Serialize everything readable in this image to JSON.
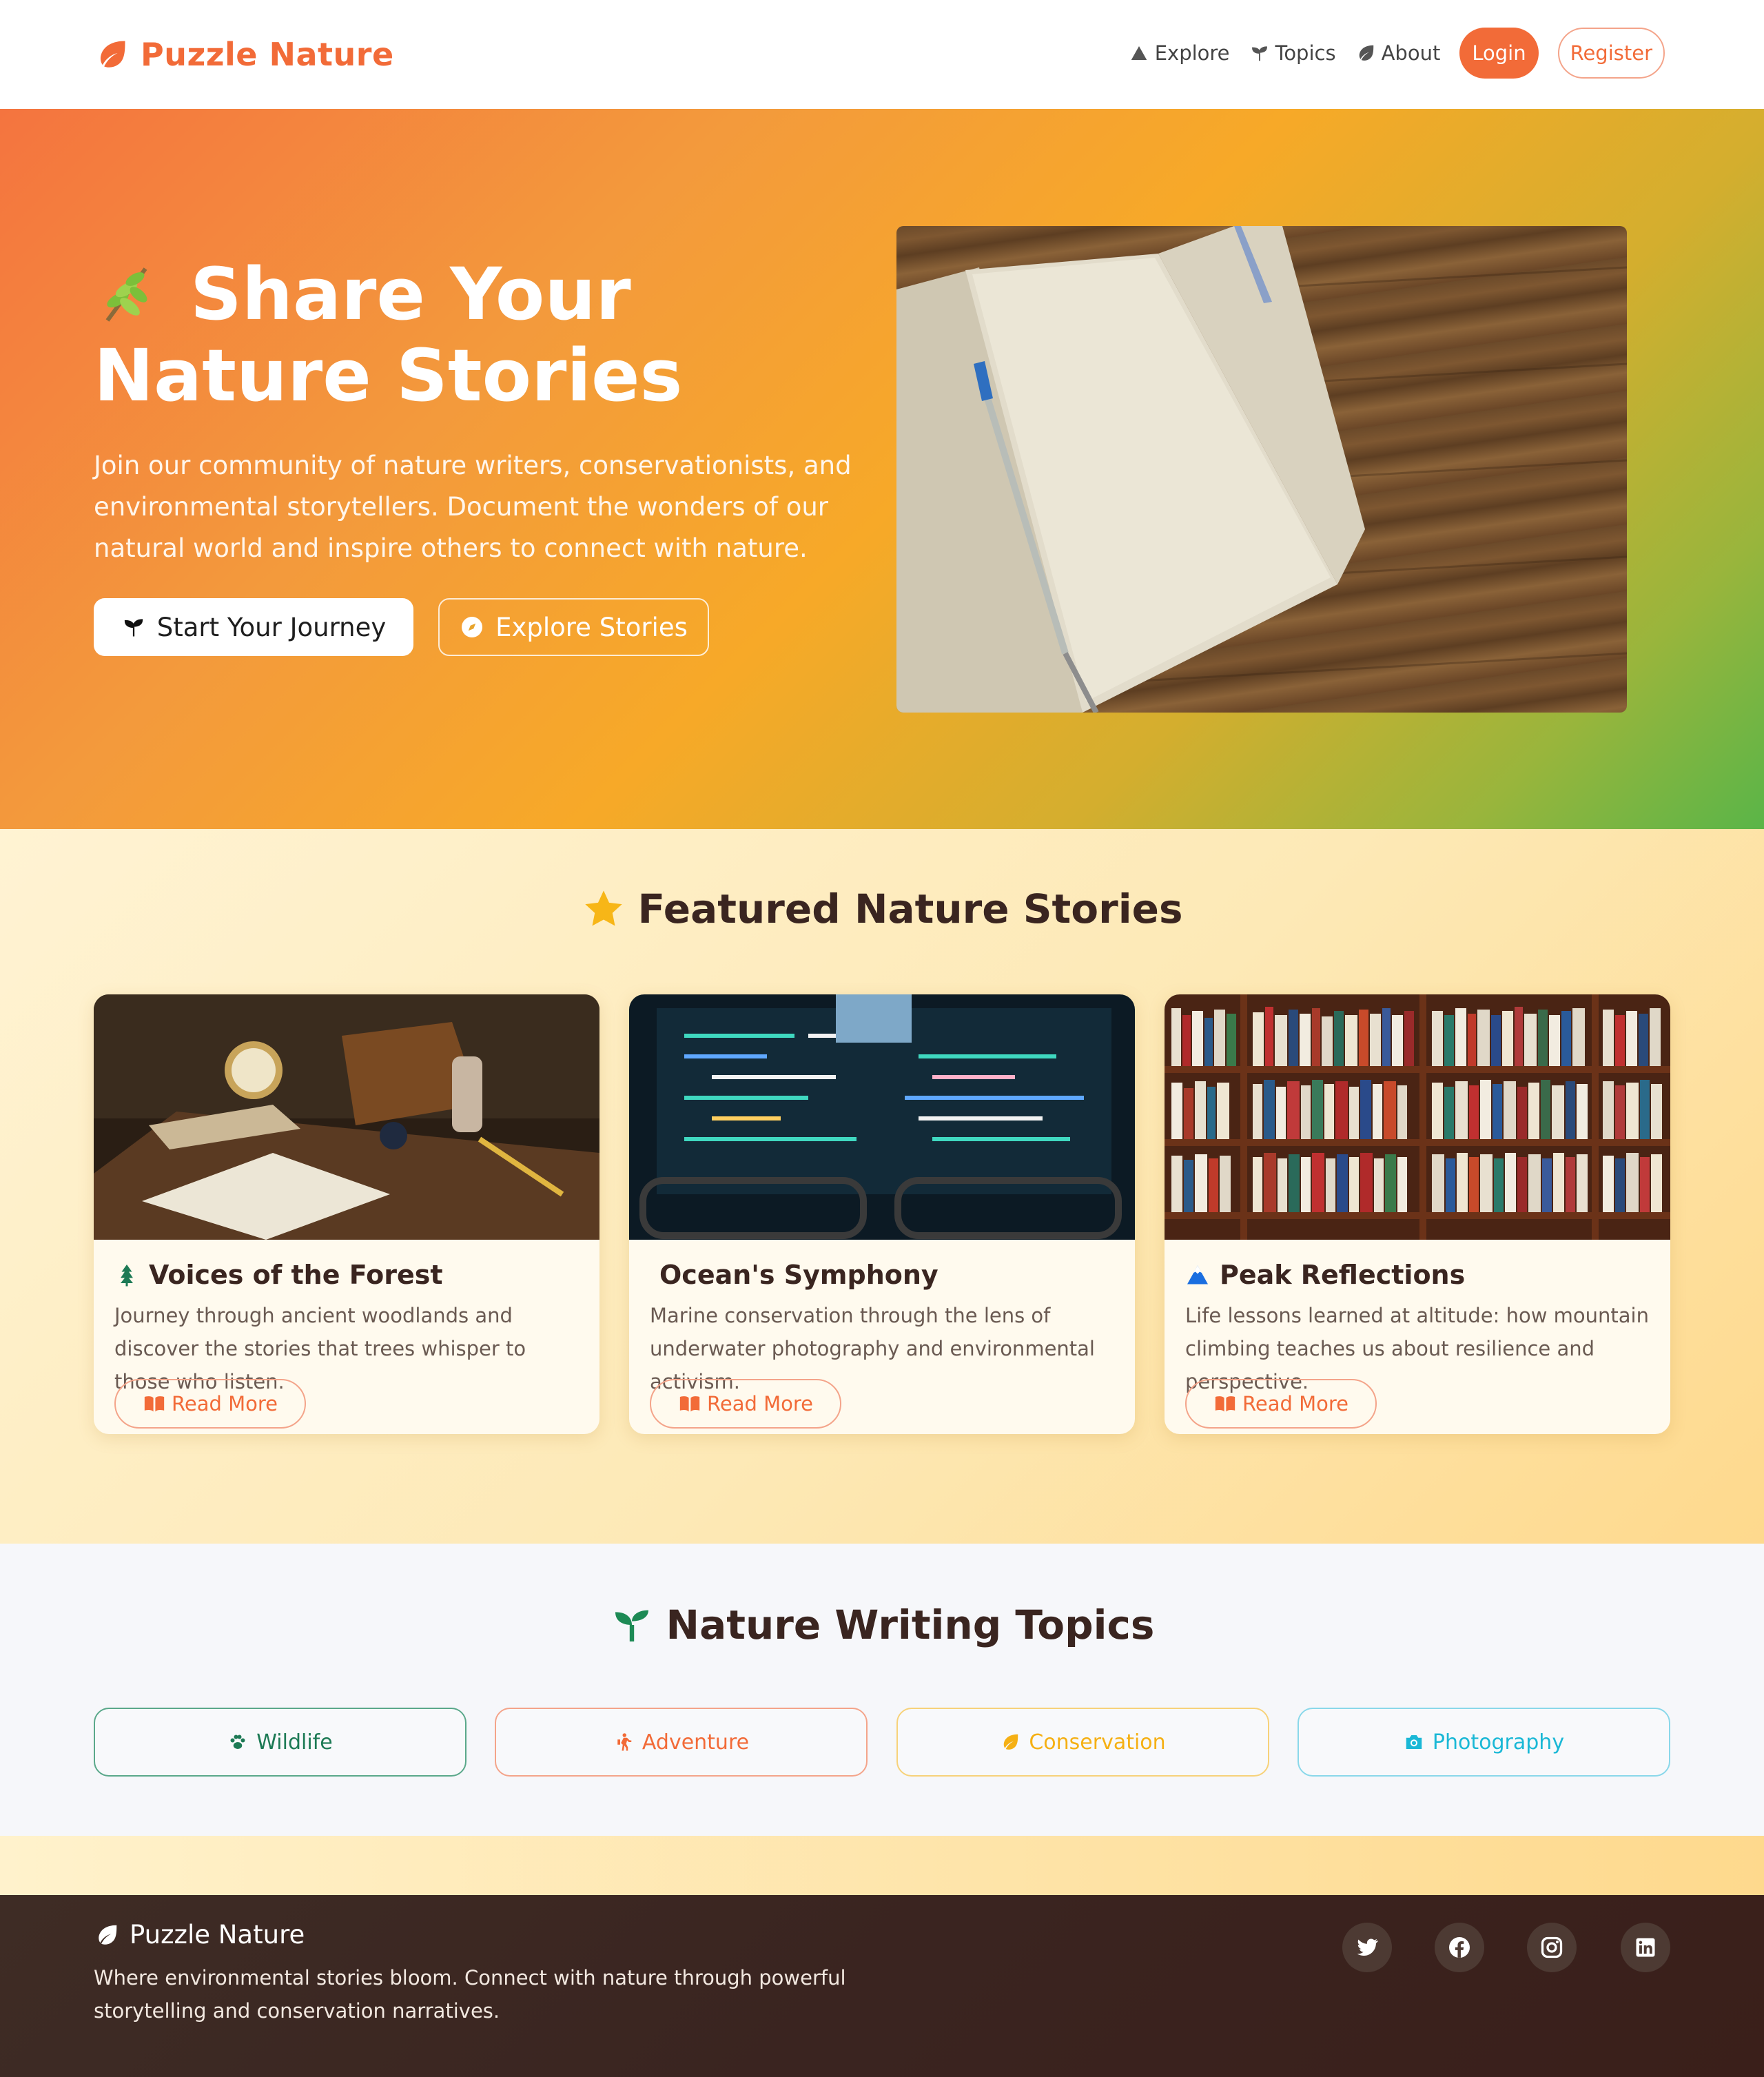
{
  "navbar": {
    "brand": "Puzzle Nature",
    "links": [
      {
        "label": "Explore",
        "icon": "mountain-icon"
      },
      {
        "label": "Topics",
        "icon": "seedling-icon"
      },
      {
        "label": "About",
        "icon": "leaf-icon"
      }
    ],
    "login": "Login",
    "register": "Register"
  },
  "hero": {
    "title": "Share Your Nature Stories",
    "description": "Join our community of nature writers, conservationists, and environmental storytellers. Document the wonders of our natural world and inspire others to connect with nature.",
    "primary_button": "Start Your Journey",
    "secondary_button": "Explore Stories"
  },
  "featured": {
    "heading": "Featured Nature Stories",
    "cards": [
      {
        "title": "Voices of the Forest",
        "icon": "tree-icon",
        "description": "Journey through ancient woodlands and discover the stories that trees whisper to those who listen.",
        "button": "Read More"
      },
      {
        "title": "Ocean's Symphony",
        "icon": "",
        "description": "Marine conservation through the lens of underwater photography and environmental activism.",
        "button": "Read More"
      },
      {
        "title": "Peak Reflections",
        "icon": "mountain-icon",
        "description": "Life lessons learned at altitude: how mountain climbing teaches us about resilience and perspective.",
        "button": "Read More"
      }
    ]
  },
  "topics": {
    "heading": "Nature Writing Topics",
    "items": [
      {
        "label": "Wildlife",
        "icon": "paw-icon",
        "color": "#1d7a55"
      },
      {
        "label": "Adventure",
        "icon": "hiking-icon",
        "color": "#f26b38"
      },
      {
        "label": "Conservation",
        "icon": "leaf-icon",
        "color": "#f5b014"
      },
      {
        "label": "Photography",
        "icon": "camera-icon",
        "color": "#1ab8d6"
      }
    ]
  },
  "footer": {
    "brand": "Puzzle Nature",
    "description": "Where environmental stories bloom. Connect with nature through powerful storytelling and conservation narratives.",
    "social": [
      "twitter-icon",
      "facebook-icon",
      "instagram-icon",
      "linkedin-icon"
    ]
  },
  "colors": {
    "accent": "#f26b38",
    "dark": "#3a2520",
    "footer": "#3a2420"
  }
}
